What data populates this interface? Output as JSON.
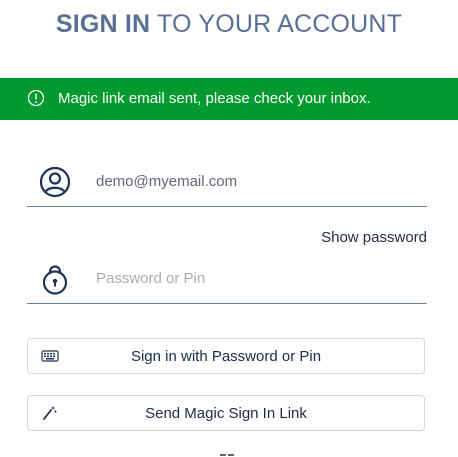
{
  "header": {
    "title_bold": "SIGN IN",
    "title_rest": " TO YOUR ACCOUNT"
  },
  "alert": {
    "icon": "info-circle-icon",
    "message": "Magic link email sent, please check your inbox.",
    "color": "#009a2e"
  },
  "form": {
    "email": {
      "icon": "user-circle-icon",
      "value": "demo@myemail.com",
      "placeholder": ""
    },
    "show_password_label": "Show password",
    "password": {
      "icon": "padlock-icon",
      "value": "",
      "placeholder": "Password or Pin"
    }
  },
  "buttons": {
    "sign_in_label": "Sign in with Password or Pin",
    "sign_in_icon": "keyboard-icon",
    "magic_link_label": "Send Magic Sign In Link",
    "magic_link_icon": "magic-wand-icon"
  },
  "colors": {
    "title": "#5a6f95",
    "button_text": "#1a2a4d",
    "icon": "#1e3158"
  }
}
